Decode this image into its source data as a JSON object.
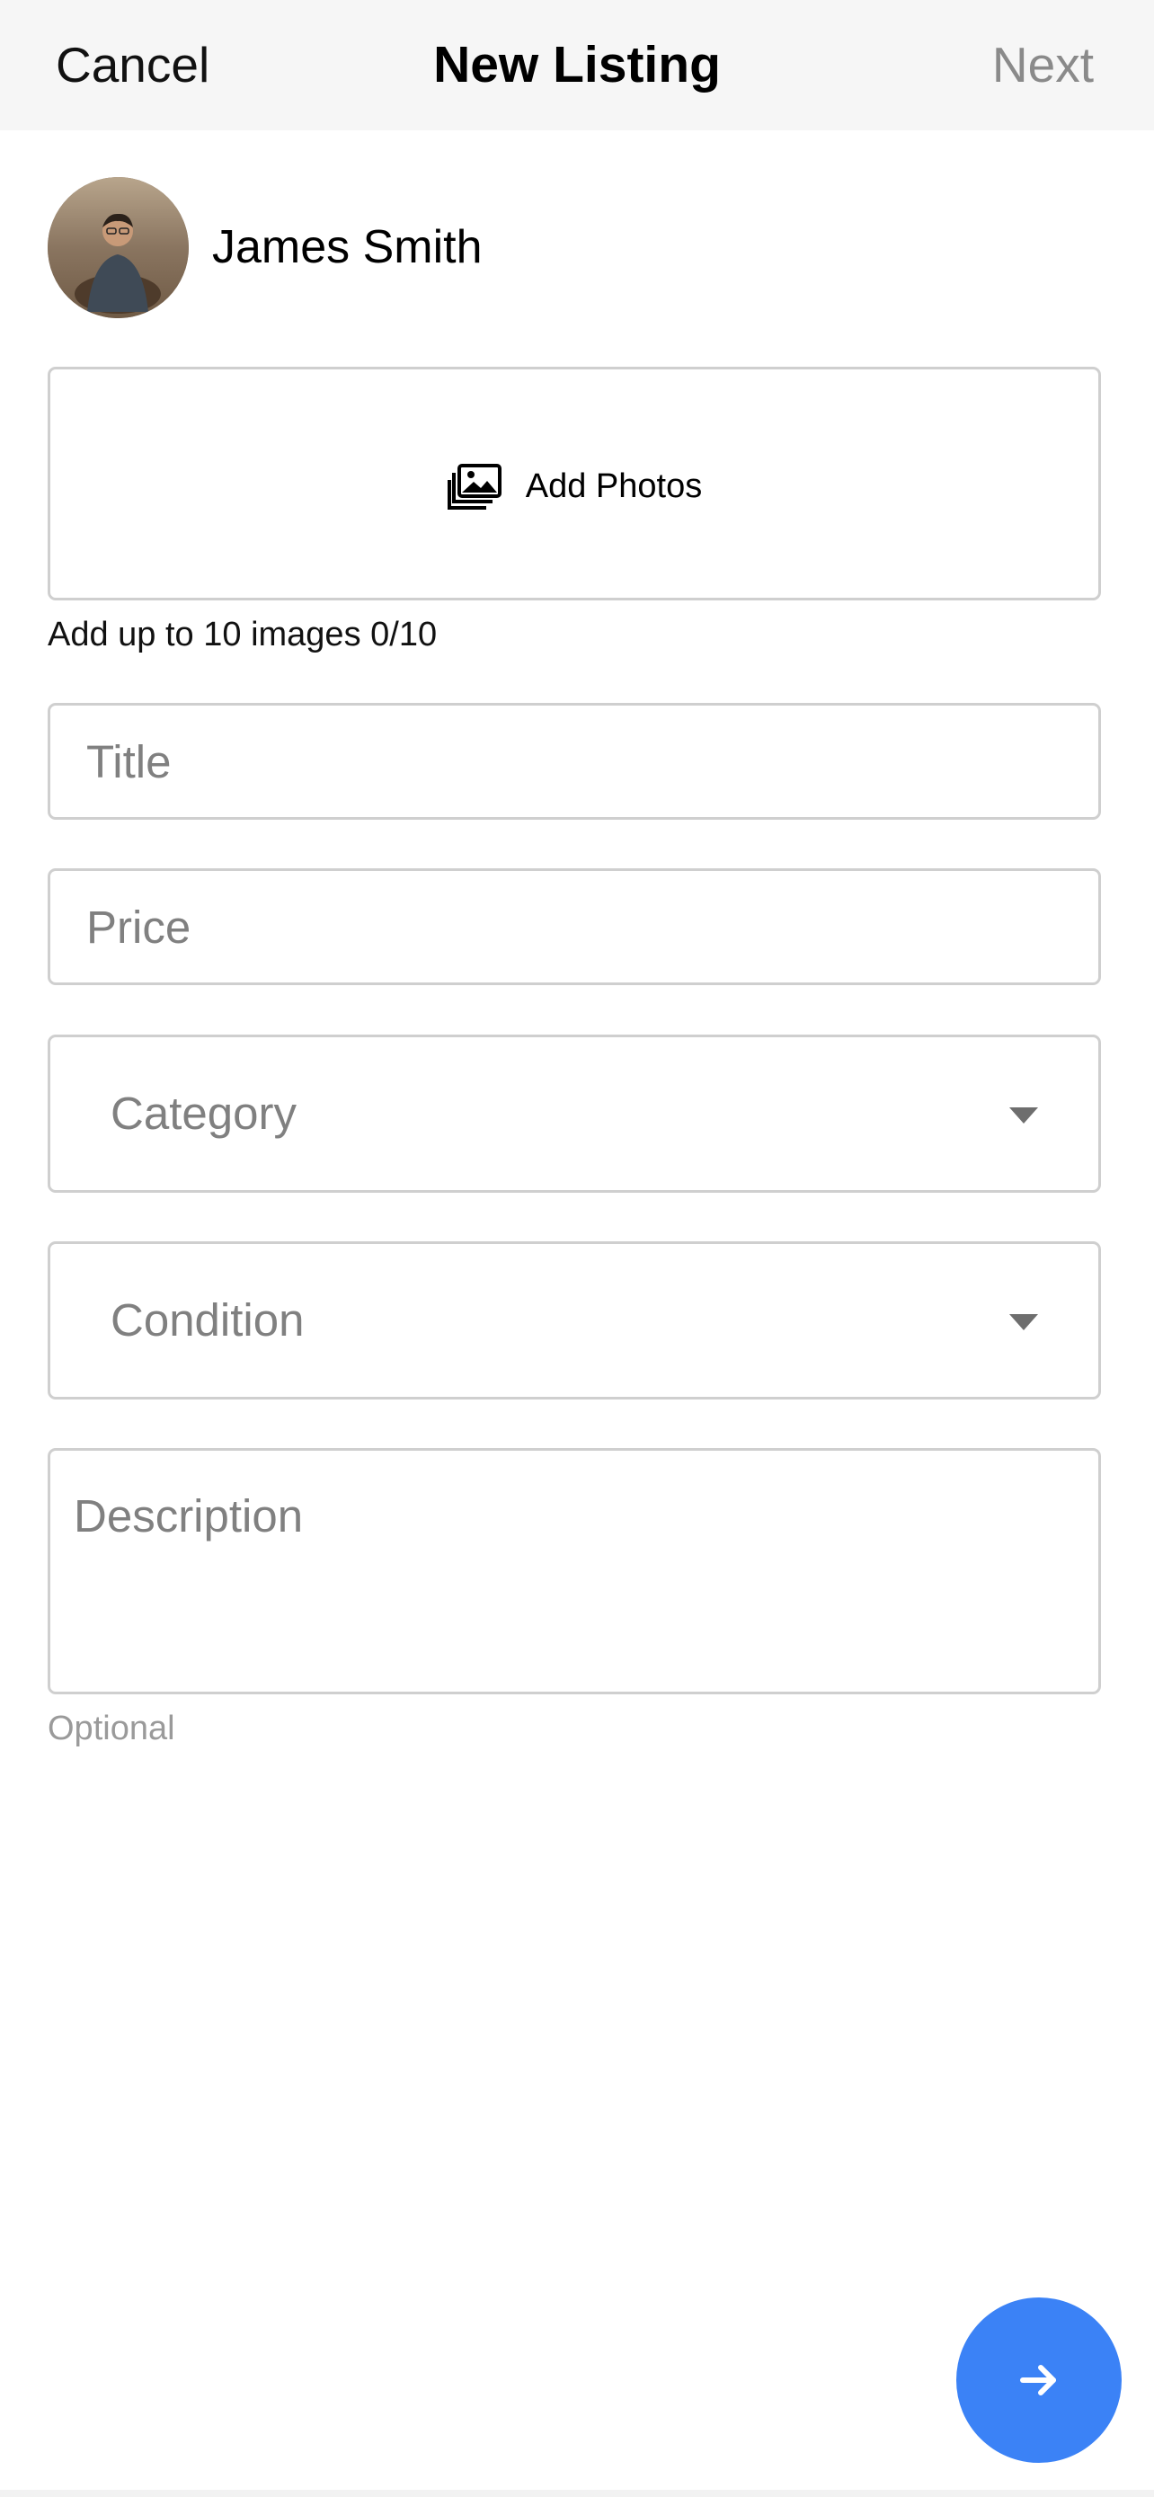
{
  "header": {
    "cancel_label": "Cancel",
    "title": "New Listing",
    "next_label": "Next"
  },
  "profile": {
    "name": "James Smith"
  },
  "photos": {
    "button_label": "Add Photos",
    "hint": "Add up to 10 images 0/10",
    "icon": "photos-icon"
  },
  "form": {
    "title_placeholder": "Title",
    "title_value": "",
    "price_placeholder": "Price",
    "price_value": "",
    "category_label": "Category",
    "condition_label": "Condition",
    "description_placeholder": "Description",
    "description_value": "",
    "description_hint": "Optional"
  },
  "fab": {
    "icon": "arrow-right-icon"
  },
  "colors": {
    "accent": "#3b82f6",
    "header_bg": "#f6f6f6",
    "border": "#cfcfcf",
    "placeholder": "#808080"
  }
}
